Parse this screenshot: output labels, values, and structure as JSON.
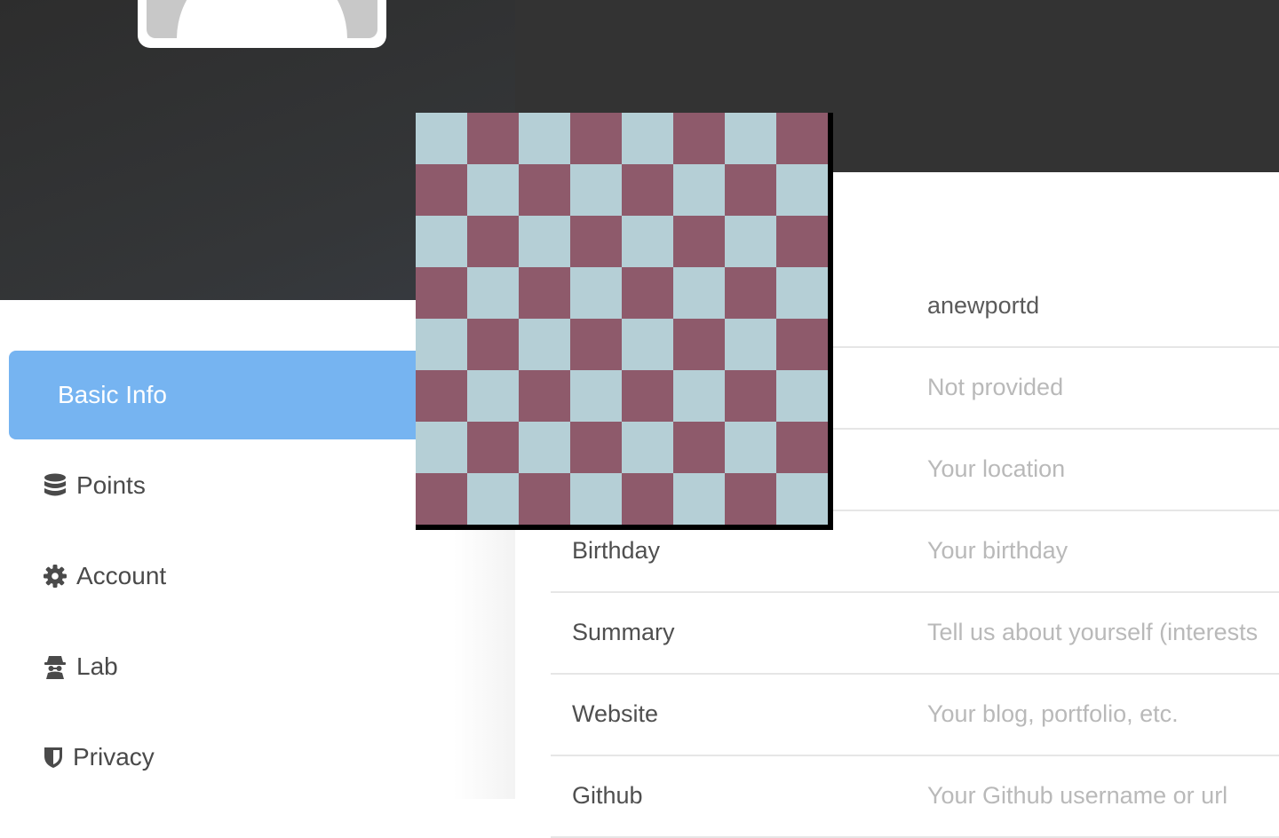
{
  "header": {
    "avatar_alt": "profile avatar"
  },
  "sidebar": {
    "items": [
      {
        "label": "Basic Info",
        "icon": "none",
        "active": true
      },
      {
        "label": "Points",
        "icon": "database-icon",
        "active": false
      },
      {
        "label": "Account",
        "icon": "gear-icon",
        "active": false
      },
      {
        "label": "Lab",
        "icon": "spy-icon",
        "active": false
      },
      {
        "label": "Privacy",
        "icon": "shield-icon",
        "active": false
      }
    ]
  },
  "form": {
    "rows": [
      {
        "label": "",
        "value": "anewportd",
        "placeholder": false
      },
      {
        "label": "",
        "value": "Not provided",
        "placeholder": true
      },
      {
        "label": "",
        "value": "Your location",
        "placeholder": true
      },
      {
        "label": "Birthday",
        "value": "Your birthday",
        "placeholder": true
      },
      {
        "label": "Summary",
        "value": "Tell us about yourself (interests",
        "placeholder": true
      },
      {
        "label": "Website",
        "value": "Your blog, portfolio, etc.",
        "placeholder": true
      },
      {
        "label": "Github",
        "value": "Your Github username or url",
        "placeholder": true
      }
    ]
  },
  "overlay": {
    "checkerboard_colors": {
      "light": "#b5cfd6",
      "dark": "#8e5a6b"
    }
  },
  "colors": {
    "accent": "#76b4f1",
    "header_dark": "#333333"
  }
}
